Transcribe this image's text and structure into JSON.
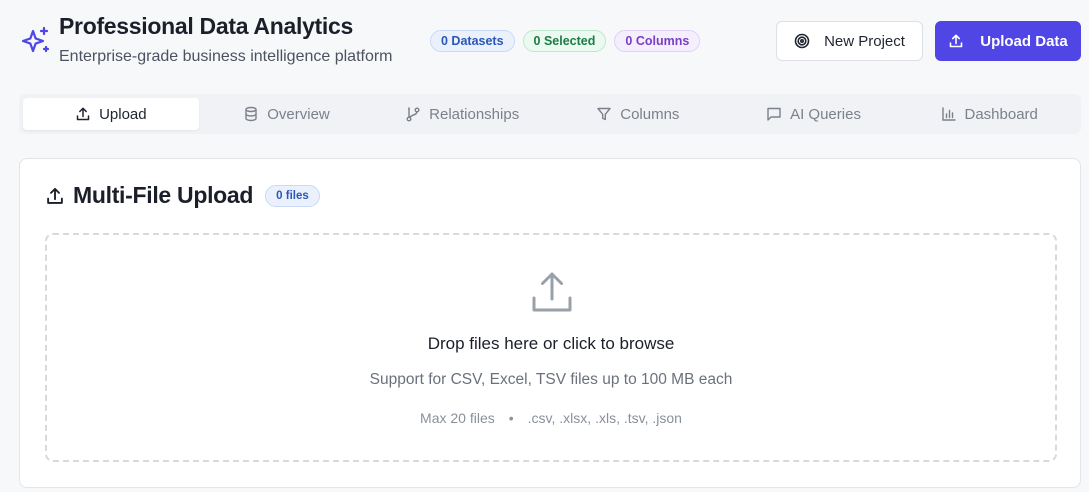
{
  "header": {
    "title": "Professional Data Analytics",
    "subtitle": "Enterprise-grade business intelligence platform",
    "badges": {
      "datasets": "0 Datasets",
      "selected": "0 Selected",
      "columns": "0 Columns"
    },
    "new_project_label": "New Project",
    "upload_label": "Upload Data",
    "accent_color": "#4f46e5"
  },
  "tabs": [
    {
      "label": "Upload",
      "icon": "upload-icon",
      "active": true
    },
    {
      "label": "Overview",
      "icon": "database-icon",
      "active": false
    },
    {
      "label": "Relationships",
      "icon": "git-branch-icon",
      "active": false
    },
    {
      "label": "Columns",
      "icon": "filter-icon",
      "active": false
    },
    {
      "label": "AI Queries",
      "icon": "message-square-icon",
      "active": false
    },
    {
      "label": "Dashboard",
      "icon": "bar-chart-icon",
      "active": false
    }
  ],
  "upload_card": {
    "title": "Multi-File Upload",
    "files_badge": "0 files",
    "dropzone": {
      "title": "Drop files here or click to browse",
      "subtitle": "Support for CSV, Excel, TSV files up to 100 MB each",
      "max_files": "Max 20 files",
      "separator": "•",
      "formats": ".csv, .xlsx, .xls, .tsv, .json"
    }
  }
}
